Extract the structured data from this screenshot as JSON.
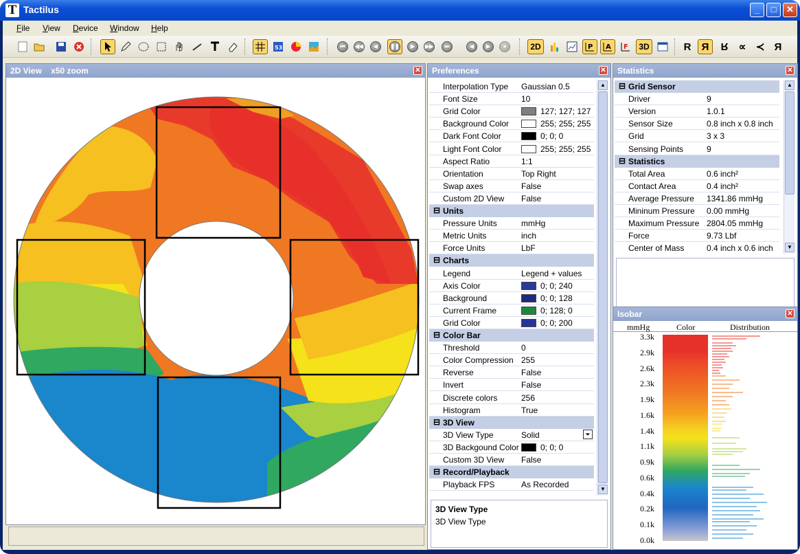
{
  "window": {
    "title": "Tactilus",
    "icon": "T"
  },
  "menu": [
    {
      "label": "File",
      "hot": "F",
      "rest": "ile"
    },
    {
      "label": "View",
      "hot": "V",
      "rest": "iew"
    },
    {
      "label": "Device",
      "hot": "D",
      "rest": "evice"
    },
    {
      "label": "Window",
      "hot": "W",
      "rest": "indow"
    },
    {
      "label": "Help",
      "hot": "H",
      "rest": "elp"
    }
  ],
  "toolbar": {
    "label_2d": "2D",
    "label_3d": "3D",
    "letters": [
      "R",
      "R",
      "R",
      "∝",
      "≺",
      "R"
    ]
  },
  "view2d": {
    "title": "2D View",
    "zoom": "x50 zoom"
  },
  "preferences": {
    "title": "Preferences",
    "rows": [
      {
        "key": "Interpolation Type",
        "value": "Gaussian 0.5"
      },
      {
        "key": "Font Size",
        "value": "10"
      },
      {
        "key": "Grid Color",
        "value": "127; 127; 127",
        "swatch": "#7f7f7f"
      },
      {
        "key": "Background Color",
        "value": "255; 255; 255",
        "swatch": "#ffffff"
      },
      {
        "key": "Dark Font Color",
        "value": "0; 0; 0",
        "swatch": "#000000"
      },
      {
        "key": "Light Font Color",
        "value": "255; 255; 255",
        "swatch": "#ffffff"
      },
      {
        "key": "Aspect Ratio",
        "value": "1:1"
      },
      {
        "key": "Orientation",
        "value": "Top Right"
      },
      {
        "key": "Swap axes",
        "value": "False"
      },
      {
        "key": "Custom 2D View",
        "value": "False"
      },
      {
        "category": "Units"
      },
      {
        "key": "Pressure Units",
        "value": "mmHg"
      },
      {
        "key": "Metric Units",
        "value": "inch"
      },
      {
        "key": "Force Units",
        "value": "LbF"
      },
      {
        "category": "Charts"
      },
      {
        "key": "Legend",
        "value": "Legend + values"
      },
      {
        "key": "Axis Color",
        "value": "0; 0; 240",
        "swatch": "#2b3a9a"
      },
      {
        "key": "Background",
        "value": "0; 0; 128",
        "swatch": "#1e2a7e"
      },
      {
        "key": "Current Frame",
        "value": "0; 128; 0",
        "swatch": "#1a8a3a"
      },
      {
        "key": "Grid Color",
        "value": "0; 0; 200",
        "swatch": "#26349a"
      },
      {
        "category": "Color Bar"
      },
      {
        "key": "Threshold",
        "value": "0"
      },
      {
        "key": "Color Compression",
        "value": "255"
      },
      {
        "key": "Reverse",
        "value": "False"
      },
      {
        "key": "Invert",
        "value": "False"
      },
      {
        "key": "Discrete colors",
        "value": "256"
      },
      {
        "key": "Histogram",
        "value": "True"
      },
      {
        "category": "3D View"
      },
      {
        "key": "3D View Type",
        "value": "Solid",
        "dropdown": true
      },
      {
        "key": "3D Backgound Color",
        "value": "0; 0; 0",
        "swatch": "#000000"
      },
      {
        "key": "Custom 3D View",
        "value": "False"
      },
      {
        "category": "Record/Playback"
      },
      {
        "key": "Playback FPS",
        "value": "As Recorded"
      }
    ],
    "desc_title": "3D View Type",
    "desc_text": "3D View Type"
  },
  "statistics": {
    "title": "Statistics",
    "rows": [
      {
        "category": "Grid Sensor"
      },
      {
        "key": "Driver",
        "value": "9"
      },
      {
        "key": "Version",
        "value": "1.0.1"
      },
      {
        "key": "Sensor Size",
        "value": "0.8 inch x 0.8 inch"
      },
      {
        "key": "Grid",
        "value": "3 x 3"
      },
      {
        "key": "Sensing Points",
        "value": "9"
      },
      {
        "category": "Statistics"
      },
      {
        "key": "Total Area",
        "value": "0.6 inch²"
      },
      {
        "key": "Contact Area",
        "value": "0.4 inch²"
      },
      {
        "key": "Average Pressure",
        "value": "1341.86 mmHg"
      },
      {
        "key": "Mininum Pressure",
        "value": "0.00 mmHg"
      },
      {
        "key": "Maximum Pressure",
        "value": "2804.05 mmHg"
      },
      {
        "key": "Force",
        "value": "9.73 Lbf"
      },
      {
        "key": "Center of Mass",
        "value": "0.4 inch x 0.6 inch"
      }
    ]
  },
  "isobar": {
    "title": "Isobar",
    "col_units": "mmHg",
    "col_color": "Color",
    "col_dist": "Distribution",
    "ticks": [
      "3.3k",
      "2.9k",
      "2.6k",
      "2.3k",
      "1.9k",
      "1.6k",
      "1.4k",
      "1.1k",
      "0.9k",
      "0.6k",
      "0.4k",
      "0.2k",
      "0.1k",
      "0.0k"
    ]
  }
}
